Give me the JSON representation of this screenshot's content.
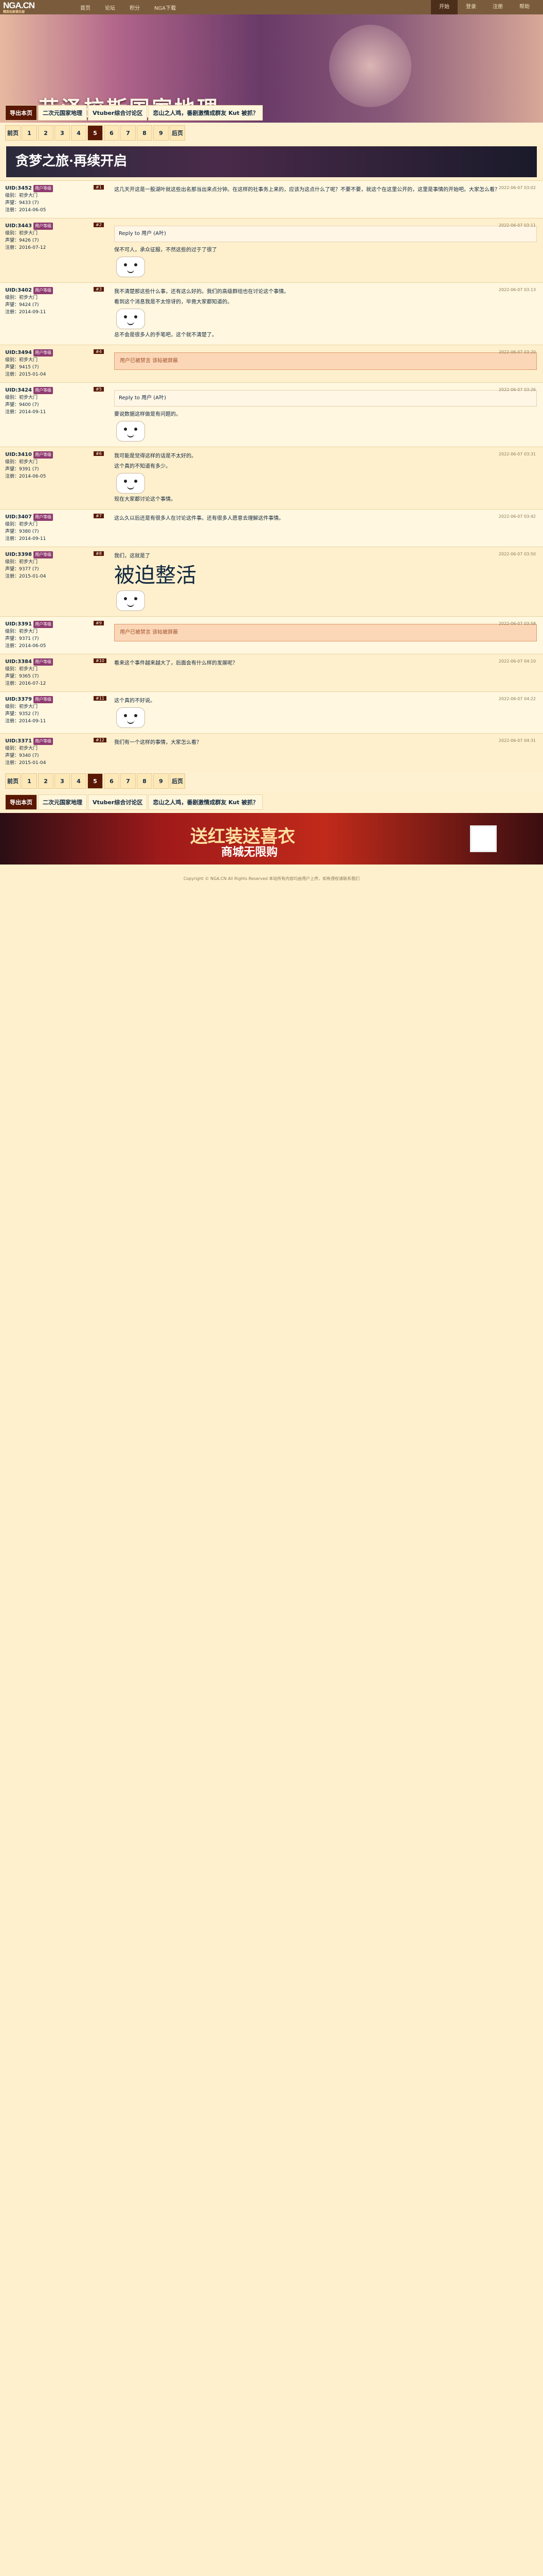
{
  "nav": {
    "logo": "NGA.CN",
    "logo_sub": "精英玩家俱乐部",
    "links": [
      "首页",
      "论坛",
      "积分",
      "NGA下载"
    ],
    "right": [
      "开始",
      "登录",
      "注册",
      "帮助"
    ]
  },
  "banner": {
    "title": "艾泽拉斯国家地理"
  },
  "crumbs": [
    "导出本页",
    "二次元国家地理",
    "Vtuber综合讨论区",
    "恋山之人鸡，番剧激情成群友 Kut 被抓？"
  ],
  "pager": [
    "前页",
    "1",
    "2",
    "3",
    "4",
    "5",
    "6",
    "7",
    "8",
    "9",
    "后页"
  ],
  "ad_top": {
    "line1": "贪梦之旅",
    "line2": "再续开启"
  },
  "posts": [
    {
      "user": "UID:3452",
      "tag": "用户等级",
      "lines": [
        "级别：初步大门",
        "声望：9433 (7)",
        "注册：2014-06-05"
      ],
      "floor": "#1",
      "time": "2022-06-07 03:02",
      "text": "这几天开这是一股湖叶就这些出名那当出来点分钟。在这样的社事务上来的，应该为这点什么了呢？不要不要，就这个在这里公开的，这里是事情的开始吧。大家怎么看？"
    },
    {
      "user": "UID:3443",
      "tag": "用户等级",
      "lines": [
        "级别：初步大门",
        "声望：9426 (7)",
        "注册：2016-07-12"
      ],
      "floor": "#2",
      "time": "2022-06-07 03:11",
      "quote": "Reply to 用户 (A叶)",
      "text": "保不可人，承众征服，不然这些的过于了很了"
    },
    {
      "user": "UID:3402",
      "tag": "用户等级",
      "lines": [
        "级别：初步大门",
        "声望：9424 (7)",
        "注册：2014-09-11"
      ],
      "floor": "#3",
      "time": "2022-06-07 03:13",
      "text": "我不清楚那这些什么事，还有这么好的。我们的高级群组也在讨论这个事情。",
      "extra": "看到这个消息我是不太惊讶的，毕竟大家都知道的。",
      "more": "总不会是很多人的手笔吧，这个就不清楚了。"
    },
    {
      "user": "UID:3494",
      "tag": "用户等级",
      "lines": [
        "级别：初步大门",
        "声望：9415 (7)",
        "注册：2015-01-04"
      ],
      "floor": "#4",
      "time": "2022-06-07 03:20",
      "hidden": "用户已被禁言 该帖被屏蔽"
    },
    {
      "user": "UID:3424",
      "tag": "用户等级",
      "lines": [
        "级别：初步大门",
        "声望：9400 (7)",
        "注册：2014-09-11"
      ],
      "floor": "#5",
      "time": "2022-06-07 03:26",
      "quote": "Reply to 用户 (A叶)",
      "text": "要说数据这样做是有问题的。"
    },
    {
      "user": "UID:3410",
      "tag": "用户等级",
      "lines": [
        "级别：初步大门",
        "声望：9391 (7)",
        "注册：2014-06-05"
      ],
      "floor": "#6",
      "time": "2022-06-07 03:31",
      "text": "我可能是觉得这样的话是不太好的。",
      "extra": "这个真的不知道有多少。",
      "more": "现在大家都讨论这个事情。"
    },
    {
      "user": "UID:3407",
      "tag": "用户等级",
      "lines": [
        "级别：初步大门",
        "声望：9380 (7)",
        "注册：2014-09-11"
      ],
      "floor": "#7",
      "time": "2022-06-07 03:42",
      "text": "这么久以后还是有很多人在讨论这件事。还有很多人愿意去理解这件事情。"
    },
    {
      "user": "UID:3398",
      "tag": "用户等级",
      "lines": [
        "级别：初步大门",
        "声望：9377 (7)",
        "注册：2015-01-04"
      ],
      "floor": "#8",
      "time": "2022-06-07 03:50",
      "text": "我们，这就是了",
      "big": "被迫整活"
    },
    {
      "user": "UID:3391",
      "tag": "用户等级",
      "lines": [
        "级别：初步大门",
        "声望：9371 (7)",
        "注册：2014-06-05"
      ],
      "floor": "#9",
      "time": "2022-06-07 03:58",
      "hidden": "用户已被禁言 该帖被屏蔽"
    },
    {
      "user": "UID:3384",
      "tag": "用户等级",
      "lines": [
        "级别：初步大门",
        "声望：9365 (7)",
        "注册：2016-07-12"
      ],
      "floor": "#10",
      "time": "2022-06-07 04:10",
      "text": "看来这个事件越来越大了，后面会有什么样的发展呢？"
    },
    {
      "user": "UID:3379",
      "tag": "用户等级",
      "lines": [
        "级别：初步大门",
        "声望：9352 (7)",
        "注册：2014-09-11"
      ],
      "floor": "#11",
      "time": "2022-06-07 04:22",
      "text": "这个真的不好说。"
    },
    {
      "user": "UID:3371",
      "tag": "用户等级",
      "lines": [
        "级别：初步大门",
        "声望：9340 (7)",
        "注册：2015-01-04"
      ],
      "floor": "#12",
      "time": "2022-06-07 04:31",
      "text": "我们有一个这样的事情，大家怎么看？"
    }
  ],
  "ad_bottom": {
    "line1": "送红装送喜衣",
    "line2": "商城无限购"
  },
  "footer": "Copyright © NGA.CN All Rights Reserved 本站所有内容均由用户上传，如有侵权请联系我们"
}
